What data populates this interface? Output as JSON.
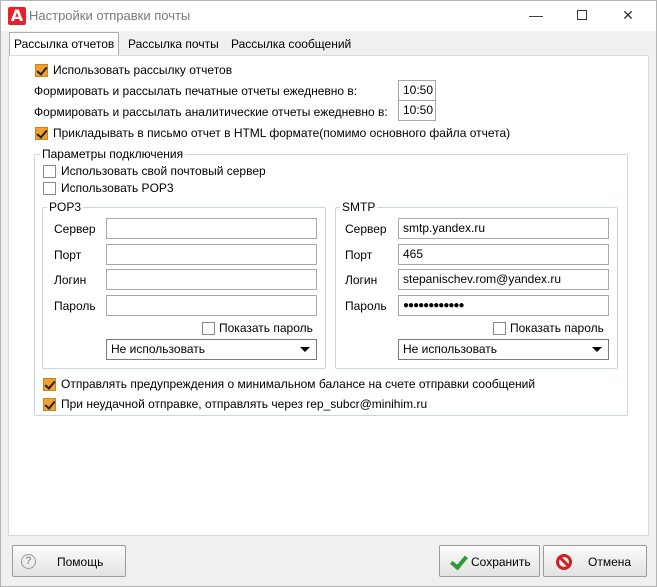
{
  "window": {
    "title": "Настройки отправки почты",
    "app_icon_letter": "A",
    "minimize": "—",
    "close": "✕"
  },
  "tabs": [
    {
      "label": "Рассылка отчетов",
      "active": true
    },
    {
      "label": "Рассылка почты",
      "active": false
    },
    {
      "label": "Рассылка сообщений",
      "active": false
    }
  ],
  "reports": {
    "use_mailing": {
      "label": "Использовать рассылку отчетов",
      "checked": true
    },
    "print_reports": {
      "label": "Формировать и рассылать печатные отчеты ежедневно в:",
      "time": "10:50"
    },
    "analytic_reports": {
      "label": "Формировать и рассылать аналитические отчеты ежедневно в:",
      "time": "10:50"
    },
    "attach_html": {
      "label": "Прикладывать в письмо отчет в HTML формате(помимо основного файла отчета)",
      "checked": true
    }
  },
  "connection": {
    "title": "Параметры подключения",
    "own_server": {
      "label": "Использовать свой почтовый сервер",
      "checked": false
    },
    "use_pop3": {
      "label": "Использовать POP3",
      "checked": false
    },
    "pop3": {
      "title": "POP3",
      "server_label": "Сервер",
      "server_value": "",
      "port_label": "Порт",
      "port_value": "",
      "login_label": "Логин",
      "login_value": "",
      "password_label": "Пароль",
      "password_value": "",
      "show_password": {
        "label": "Показать пароль",
        "checked": false
      },
      "encryption": "Не использовать"
    },
    "smtp": {
      "title": "SMTP",
      "server_label": "Сервер",
      "server_value": "smtp.yandex.ru",
      "port_label": "Порт",
      "port_value": "465",
      "login_label": "Логин",
      "login_value": "stepanischev.rom@yandex.ru",
      "password_label": "Пароль",
      "password_value": "●●●●●●●●●●●●",
      "show_password": {
        "label": "Показать пароль",
        "checked": false
      },
      "encryption": "Не использовать"
    },
    "min_balance_warning": {
      "label": "Отправлять предупреждения о минимальном балансе на счете отправки сообщений",
      "checked": true
    },
    "fallback_send": {
      "label": "При неудачной отправке, отправлять через rep_subcr@minihim.ru",
      "checked": true
    }
  },
  "footer": {
    "help_label": "Помощь",
    "help_icon": "?",
    "save_label": "Сохранить",
    "cancel_label": "Отмена"
  }
}
